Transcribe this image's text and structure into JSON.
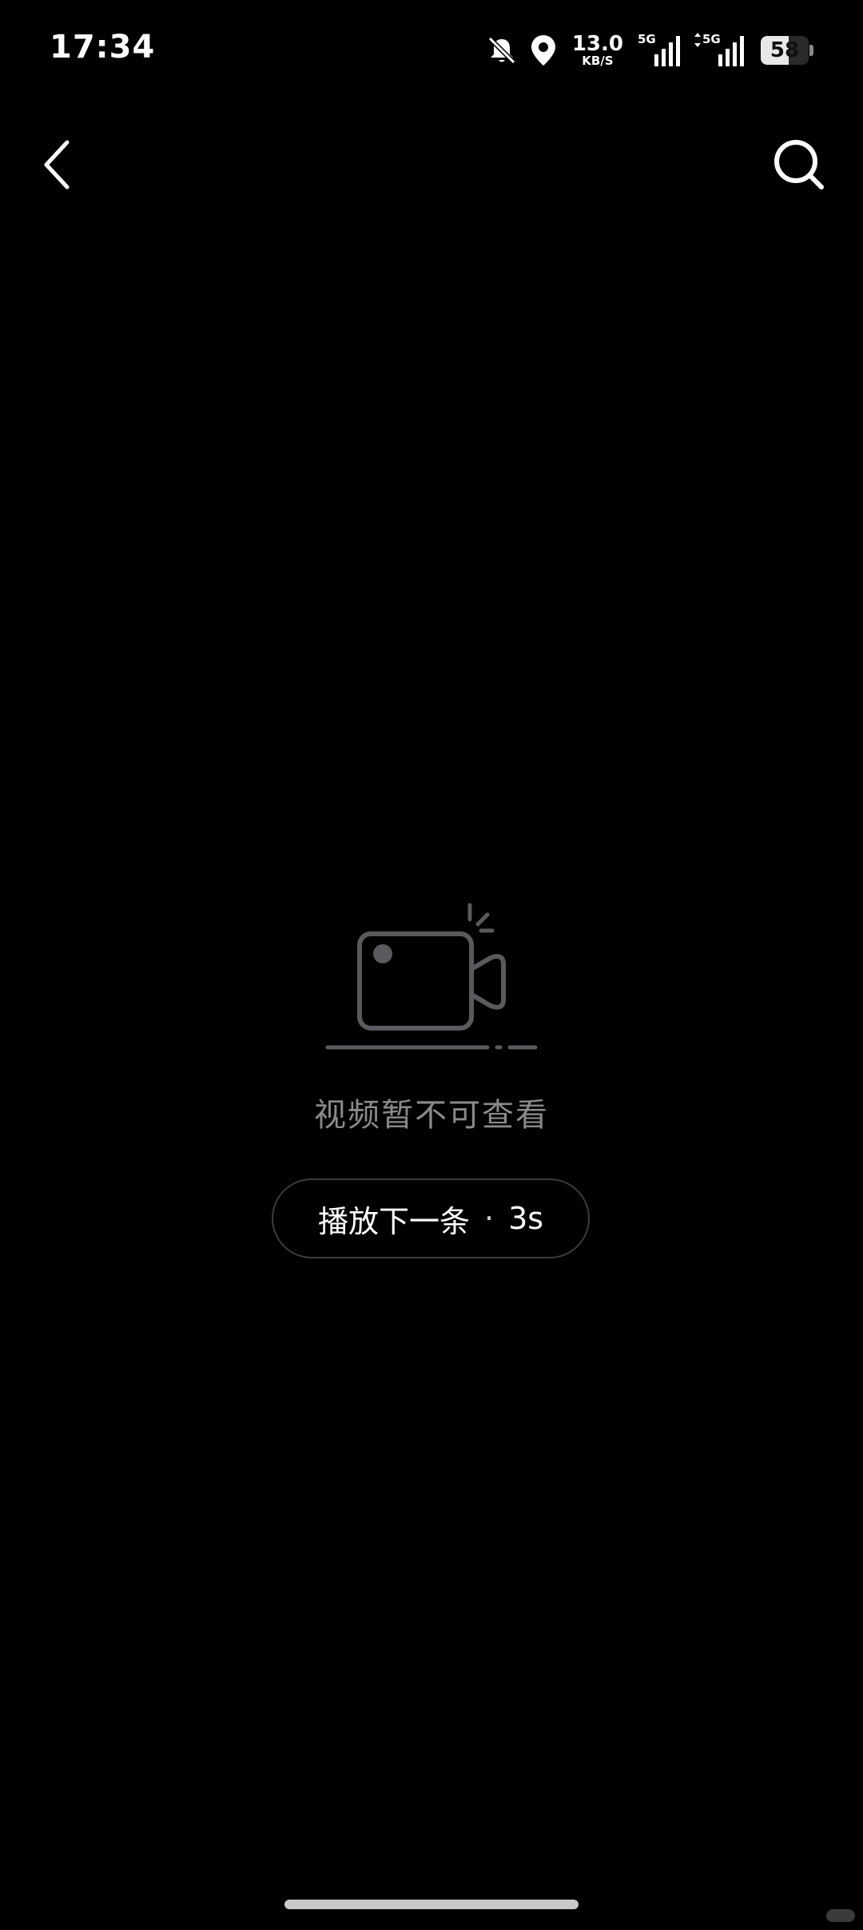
{
  "status_bar": {
    "time": "17:34",
    "net_speed_value": "13.0",
    "net_speed_unit": "KB/S",
    "sim1_label": "5G",
    "sim2_label": "5G",
    "battery_level": "58",
    "battery_fraction": 0.58,
    "icons": [
      "bell-muted-icon",
      "location-icon",
      "signal-icon",
      "signal-icon",
      "battery-icon"
    ]
  },
  "nav": {
    "back_icon": "chevron-left-icon",
    "search_icon": "search-icon"
  },
  "empty_state": {
    "illustration_icon": "video-camera-icon",
    "message": "视频暂不可查看"
  },
  "next_button": {
    "label": "播放下一条",
    "separator": "·",
    "countdown": "3s"
  },
  "colors": {
    "background": "#000000",
    "foreground": "#ffffff",
    "muted_text": "#8a8a8e",
    "illustration": "#5a5a5e",
    "button_border": "#3c3c3e"
  }
}
